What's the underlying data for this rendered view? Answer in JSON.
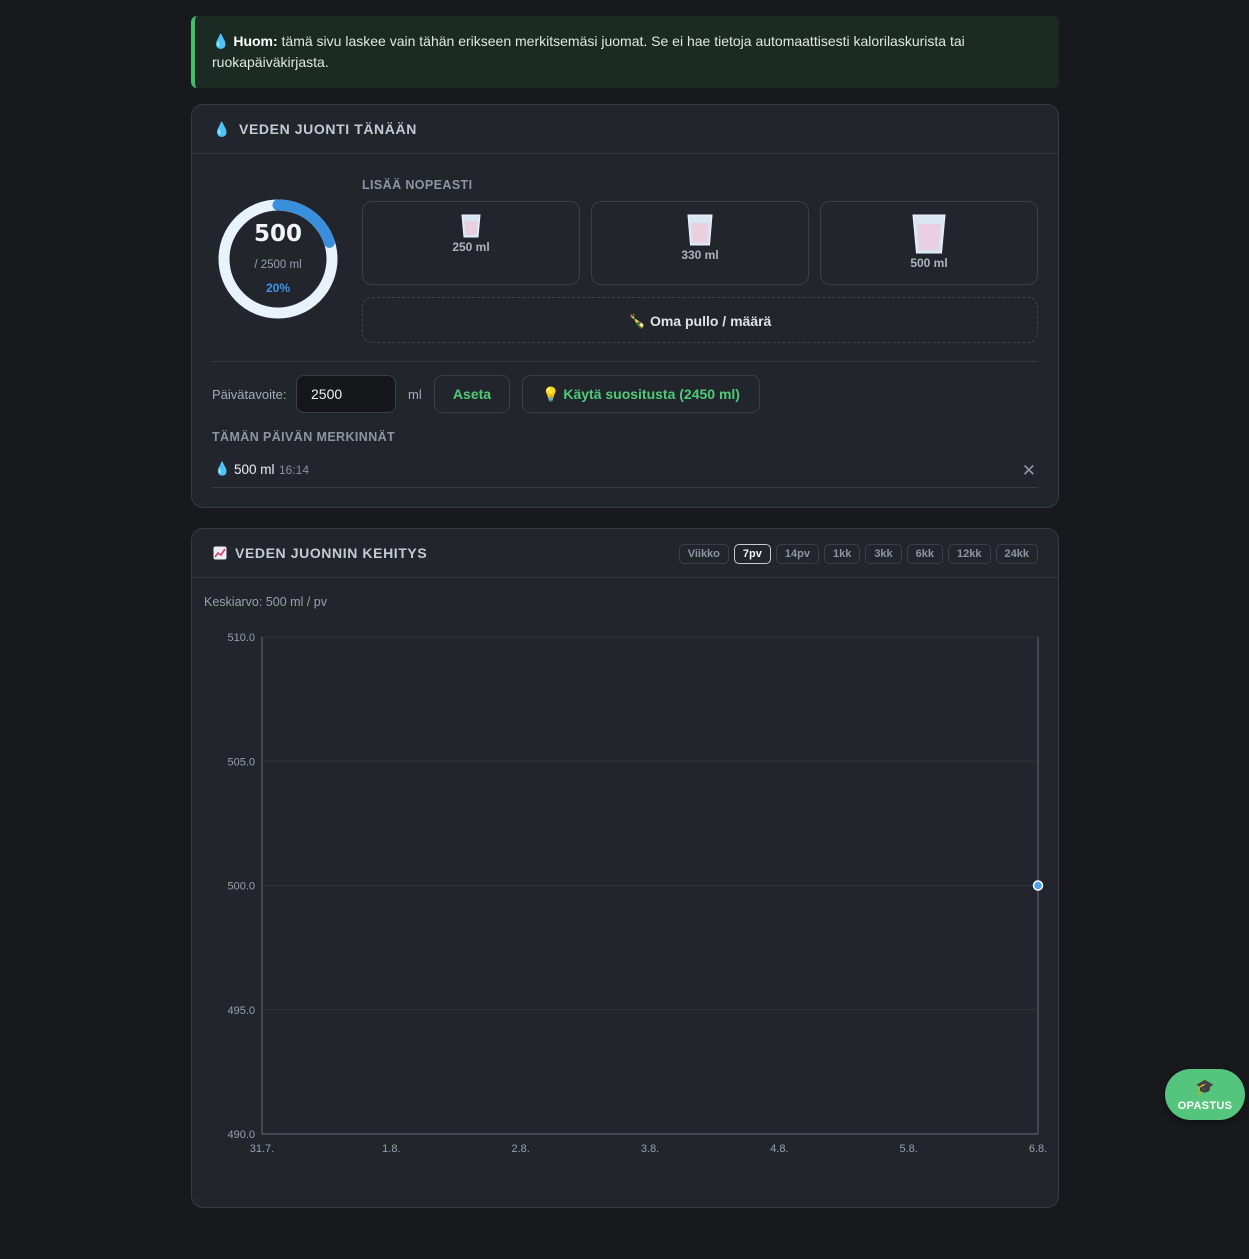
{
  "notice": {
    "bold": "Huom:",
    "text": " tämä sivu laskee vain tähän erikseen merkitsemäsi juomat. Se ei hae tietoja automaattisesti kalorilaskurista tai ruokapäiväkirjasta."
  },
  "today_card": {
    "title": "VEDEN JUONTI TÄNÄÄN",
    "ring": {
      "value": "500",
      "goal_text": "/ 2500 ml",
      "percent_text": "20%",
      "progress": 0.2
    },
    "quick_add": {
      "label": "LISÄÄ NOPEASTI",
      "buttons": [
        {
          "label": "250 ml"
        },
        {
          "label": "330 ml"
        },
        {
          "label": "500 ml"
        }
      ],
      "custom_label": "Oma pullo / määrä"
    },
    "goal": {
      "label": "Päivätavoite:",
      "value": "2500",
      "unit": "ml",
      "set_label": "Aseta",
      "recommend_label": "Käytä suositusta (2450 ml)"
    },
    "entries_label": "TÄMÄN PÄIVÄN MERKINNÄT",
    "entries": [
      {
        "amount": "500 ml",
        "time": "16:14"
      }
    ]
  },
  "trend_card": {
    "title": "VEDEN JUONNIN KEHITYS",
    "ranges": [
      "Viikko",
      "7pv",
      "14pv",
      "1kk",
      "3kk",
      "6kk",
      "12kk",
      "24kk"
    ],
    "active_range": "7pv",
    "average_text": "Keskiarvo: 500 ml / pv"
  },
  "chart_data": {
    "type": "line",
    "x": [
      "31.7.",
      "1.8.",
      "2.8.",
      "3.8.",
      "4.8.",
      "5.8.",
      "6.8."
    ],
    "series": [
      {
        "points": [
          {
            "x": "6.8.",
            "y": 500
          }
        ]
      }
    ],
    "ylim": [
      490,
      510
    ],
    "yticks": [
      "510.0",
      "505.0",
      "500.0",
      "495.0",
      "490.0"
    ],
    "grid": true,
    "color": "#4aa3ef"
  },
  "fab": {
    "label": "OPASTUS",
    "icon": "graduation-cap-icon"
  }
}
